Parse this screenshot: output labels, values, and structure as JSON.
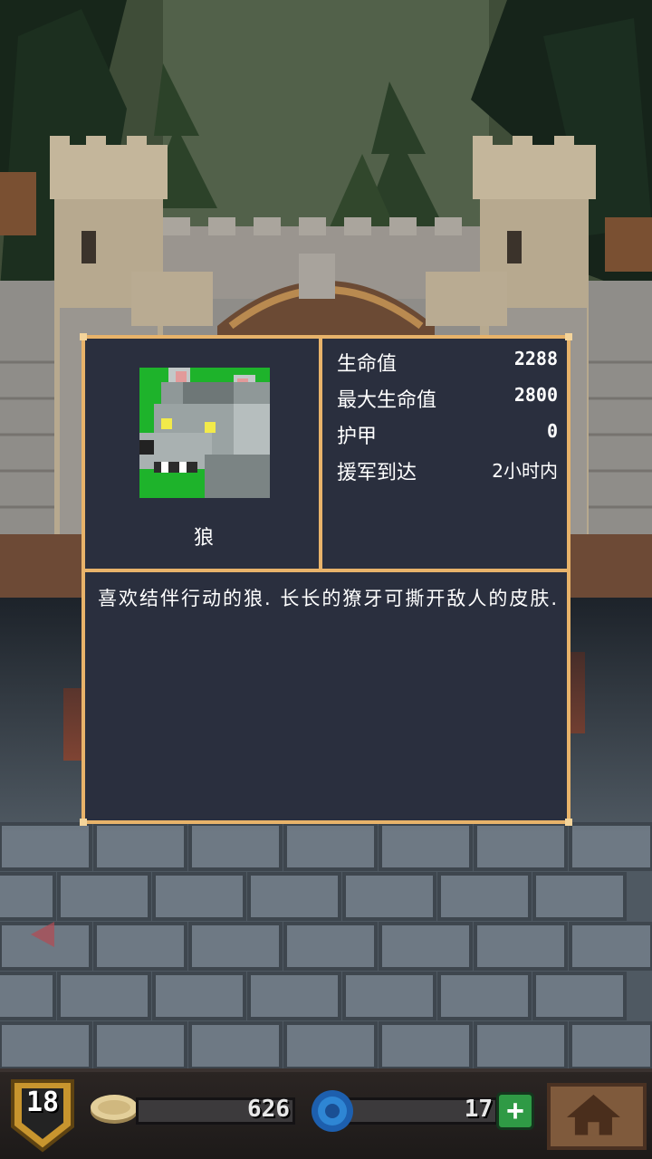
{
  "monster": {
    "name": "狼",
    "portrait_icon": "wolf-icon",
    "description": "喜欢结伴行动的狼. 长长的獠牙可撕开敌人的皮肤."
  },
  "stats": [
    {
      "label": "生命值",
      "value": "2288"
    },
    {
      "label": "最大生命值",
      "value": "2800"
    },
    {
      "label": "护甲",
      "value": "0"
    },
    {
      "label": "援军到达",
      "value": "2小时内"
    }
  ],
  "hud": {
    "level": "18",
    "gold": "626",
    "gems": "17",
    "add_label": "+",
    "home_icon": "home-icon"
  },
  "colors": {
    "dialog_border": "#e8b36a",
    "dialog_bg": "#2a2f3e",
    "portrait_bg": "#1eb32b"
  }
}
